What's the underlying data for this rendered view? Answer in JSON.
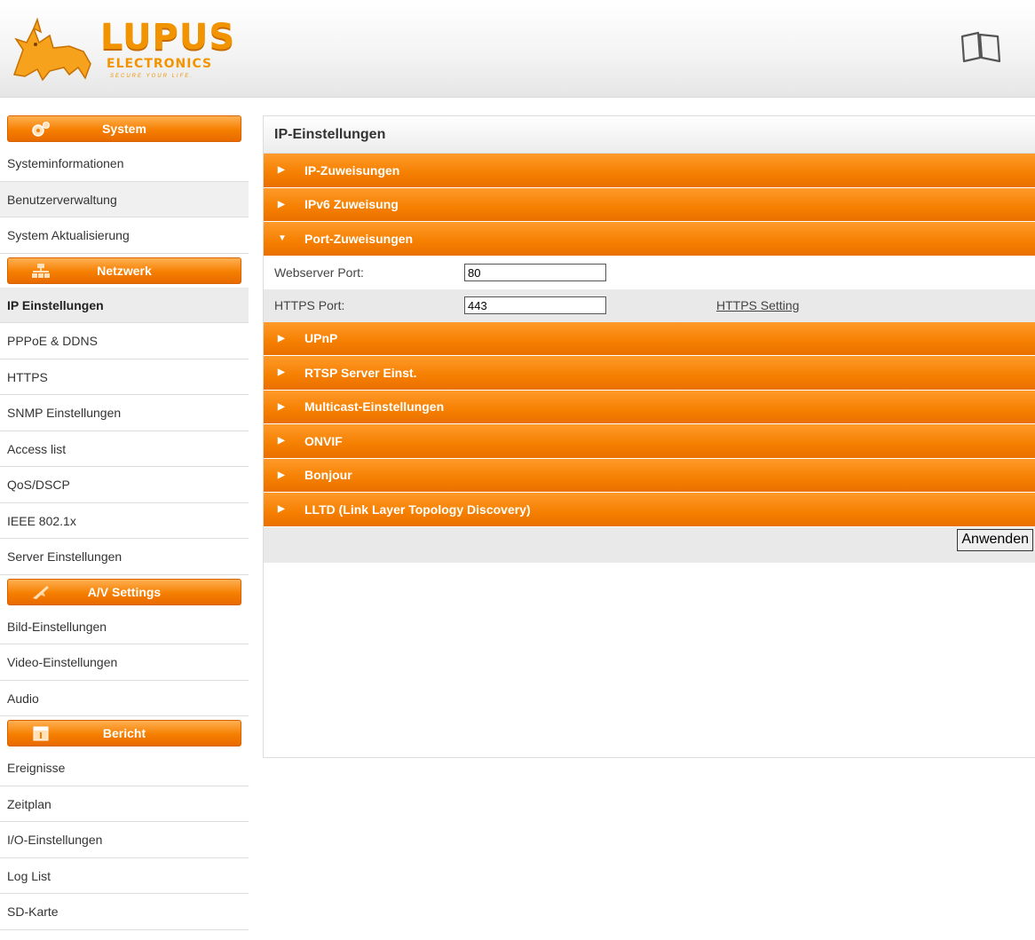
{
  "logo": {
    "brand": "LUPUS",
    "sub": "ELECTRONICS",
    "slogan": "SECURE YOUR LIFE."
  },
  "sidebar": {
    "groups": [
      {
        "title": "System",
        "icon": "gears-icon",
        "items": [
          "Systeminformationen",
          "Benutzerverwaltung",
          "System Aktualisierung"
        ]
      },
      {
        "title": "Netzwerk",
        "icon": "network-icon",
        "items": [
          "IP Einstellungen",
          "PPPoE & DDNS",
          "HTTPS",
          "SNMP Einstellungen",
          "Access list",
          "QoS/DSCP",
          "IEEE 802.1x",
          "Server Einstellungen"
        ]
      },
      {
        "title": "A/V Settings",
        "icon": "av-icon",
        "items": [
          "Bild-Einstellungen",
          "Video-Einstellungen",
          "Audio"
        ]
      },
      {
        "title": "Bericht",
        "icon": "calendar-icon",
        "items": [
          "Ereignisse",
          "Zeitplan",
          "I/O-Einstellungen",
          "Log List",
          "SD-Karte"
        ]
      }
    ],
    "active_item": "IP Einstellungen"
  },
  "main": {
    "title": "IP-Einstellungen",
    "sections": [
      "IP-Zuweisungen",
      "IPv6 Zuweisung",
      "Port-Zuweisungen",
      "UPnP",
      "RTSP Server Einst.",
      "Multicast-Einstellungen",
      "ONVIF",
      "Bonjour",
      "LLTD (Link Layer Topology Discovery)"
    ],
    "expanded_section": "Port-Zuweisungen",
    "ports": {
      "webserver_label": "Webserver Port:",
      "webserver_value": "80",
      "https_label": "HTTPS Port:",
      "https_value": "443",
      "https_link": "HTTPS Setting"
    },
    "apply_label": "Anwenden"
  },
  "colors": {
    "accent": "#f57f00",
    "accent_light": "#ffb053"
  }
}
